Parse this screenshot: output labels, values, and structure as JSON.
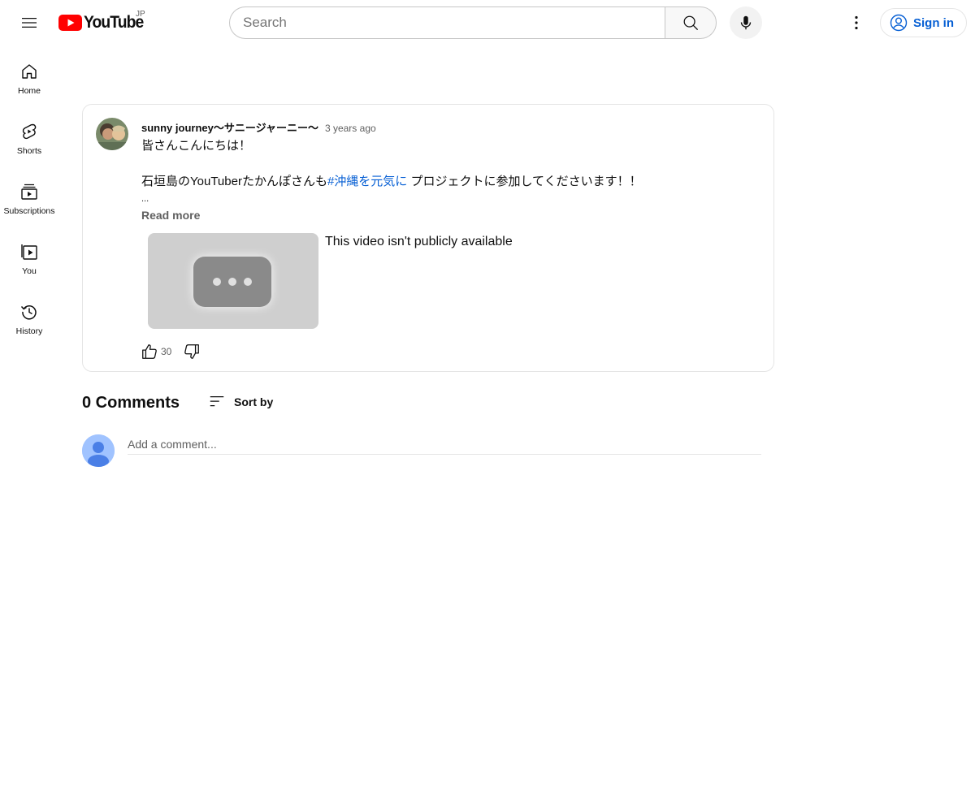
{
  "header": {
    "logo_text": "YouTube",
    "country_code": "JP",
    "search_placeholder": "Search",
    "sign_in_label": "Sign in"
  },
  "sidebar": {
    "items": [
      {
        "label": "Home",
        "icon": "home-icon"
      },
      {
        "label": "Shorts",
        "icon": "shorts-icon"
      },
      {
        "label": "Subscriptions",
        "icon": "subscriptions-icon"
      },
      {
        "label": "You",
        "icon": "you-icon"
      },
      {
        "label": "History",
        "icon": "history-icon"
      }
    ]
  },
  "post": {
    "author": "sunny journey〜サニージャーニー〜",
    "time": "3 years ago",
    "line1": "皆さんこんにちは！",
    "line2_before": "石垣島のYouTuberたかんぽさんも",
    "hashtag": "#沖縄を元気に",
    "line2_after": " プロジェクトに参加してくださいます！！",
    "ellipsis": "...",
    "read_more": "Read more",
    "video_status": "This video isn't publicly available",
    "like_count": "30"
  },
  "comments": {
    "title": "0 Comments",
    "sort_label": "Sort by",
    "input_placeholder": "Add a comment..."
  },
  "colors": {
    "brand_red": "#ff0000",
    "link_blue": "#065fd4"
  }
}
